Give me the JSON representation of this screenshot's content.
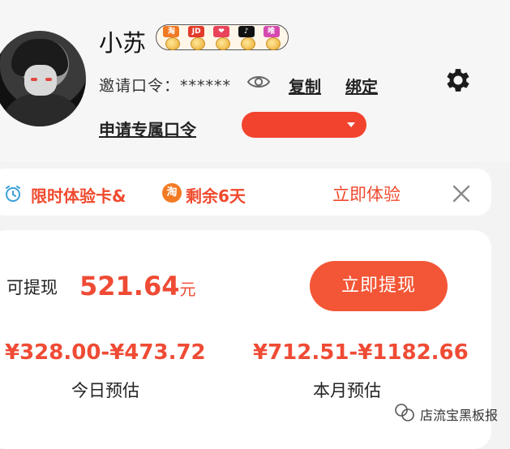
{
  "profile": {
    "name": "小苏",
    "badges": [
      {
        "label": "淘",
        "color": "#f27a24"
      },
      {
        "label": "JD",
        "color": "#e23b2b"
      },
      {
        "label": "❤",
        "color": "#e8435a"
      },
      {
        "label": "♪",
        "color": "#111111"
      },
      {
        "label": "唯",
        "color": "#d64ab0"
      }
    ],
    "invite_label": "邀请口令：******",
    "copy_label": "复制",
    "bind_label": "绑定",
    "apply_label": "申请专属口令"
  },
  "trial": {
    "title": "限时体验卡&",
    "platform_icon": "淘",
    "remaining": "剩余6天",
    "action": "立即体验"
  },
  "earnings": {
    "withdraw_label": "可提现",
    "amount": "521.64",
    "unit": "元",
    "withdraw_button": "立即提现",
    "today_range": "¥328.00-¥473.72",
    "today_label": "今日预估",
    "month_range": "¥712.51-¥1182.66",
    "month_label": "本月预估"
  },
  "watermark": {
    "text": "店流宝黑板报"
  },
  "colors": {
    "accent": "#f04a2e",
    "button": "#f35636"
  }
}
